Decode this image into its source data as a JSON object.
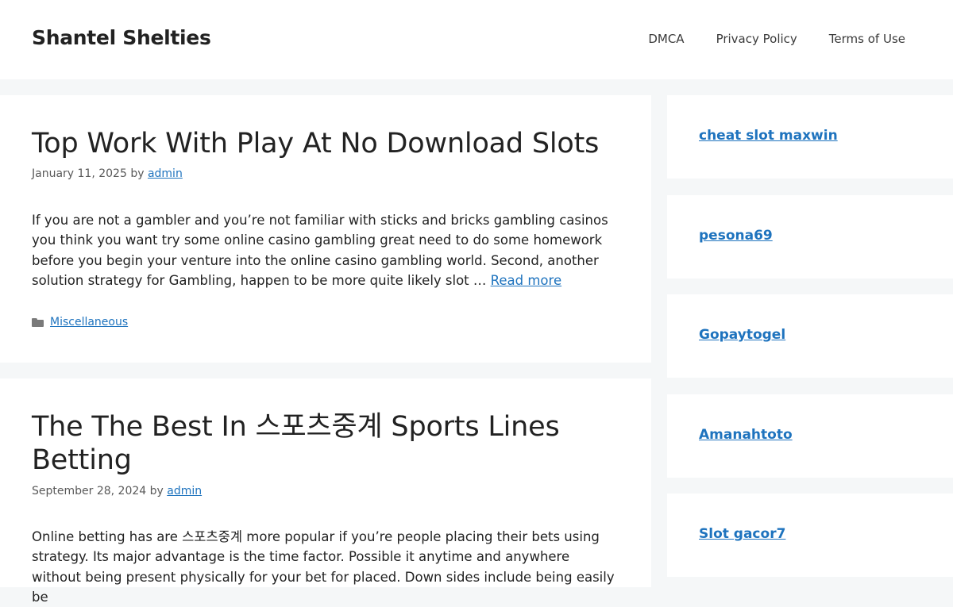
{
  "site": {
    "title": "Shantel Shelties"
  },
  "nav": [
    {
      "label": "DMCA"
    },
    {
      "label": "Privacy Policy"
    },
    {
      "label": "Terms of Use"
    }
  ],
  "posts": [
    {
      "title": "Top Work With Play At No Download Slots",
      "date": "January 11, 2025",
      "by": "by",
      "author": "admin",
      "excerpt": "If you are not a gambler and you’re not familiar with sticks and bricks gambling casinos you think you want try some online casino gambling great need to do some homework before you begin your venture into the online casino gambling world. Second, another solution strategy for Gambling, happen to be more quite likely slot … ",
      "read_more": "Read more",
      "category": "Miscellaneous",
      "category_icon": "folder-icon"
    },
    {
      "title": "The The Best In 스포츠중계 Sports Lines Betting",
      "date": "September 28, 2024",
      "by": "by",
      "author": "admin",
      "excerpt": "Online betting has are 스포츠중계 more popular if you’re people placing their bets using strategy. Its major advantage is the time factor. Possible it anytime and anywhere without being present physically for your bet for placed. Down sides include being easily be"
    }
  ],
  "sidebar": [
    {
      "label": "cheat slot maxwin"
    },
    {
      "label": "pesona69"
    },
    {
      "label": "Gopaytogel"
    },
    {
      "label": "Amanahtoto"
    },
    {
      "label": "Slot gacor7"
    }
  ],
  "colors": {
    "link": "#1e73be",
    "background": "#f5f7f8",
    "text": "#222222"
  }
}
